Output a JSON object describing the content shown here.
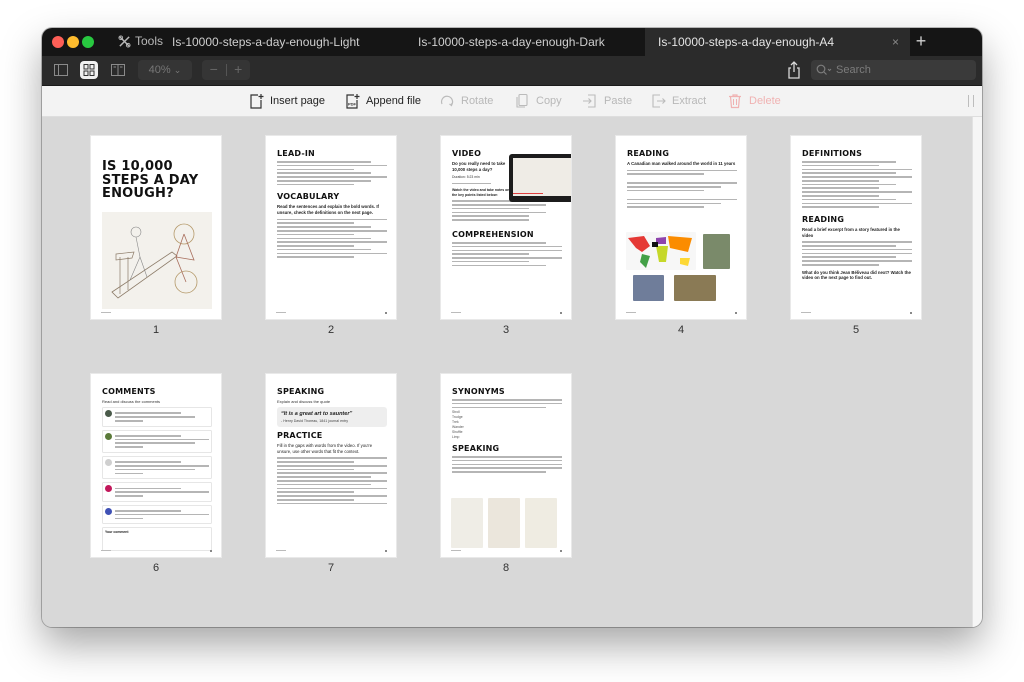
{
  "window": {
    "tools_label": "Tools",
    "tabs": [
      {
        "label": "Is-10000-steps-a-day-enough-Light",
        "active": false
      },
      {
        "label": "Is-10000-steps-a-day-enough-Dark",
        "active": false
      },
      {
        "label": "Is-10000-steps-a-day-enough-A4",
        "active": true
      }
    ],
    "close_glyph": "×",
    "new_tab_glyph": "+"
  },
  "toolbar": {
    "zoom_value": "40%",
    "zoom_chevron": "⌄",
    "zoom_out": "−",
    "zoom_in": "+",
    "search_placeholder": "Search",
    "view_modes": [
      "sidebar-view",
      "grid-view",
      "two-page-view"
    ],
    "active_view": "grid-view"
  },
  "actions": {
    "insert_page": "Insert page",
    "append_file": "Append file",
    "rotate": "Rotate",
    "copy": "Copy",
    "paste": "Paste",
    "extract": "Extract",
    "delete": "Delete"
  },
  "colors": {
    "traffic_red": "#fe5f57",
    "traffic_yellow": "#febc2e",
    "traffic_green": "#28c840",
    "delete_disabled": "#f0b2b2"
  },
  "pages": [
    {
      "number": "1",
      "title": "IS 10,000 STEPS A DAY ENOUGH?"
    },
    {
      "number": "2",
      "headings": [
        "LEAD-IN",
        "VOCABULARY"
      ],
      "vocab_instructions": "Read the sentences and explain the bold words. If unsure, check the definitions on the next page."
    },
    {
      "number": "3",
      "headings": [
        "VIDEO",
        "COMPREHENSION"
      ],
      "video_question": "Do you really need to take 10,000 steps a day?",
      "duration": "Duration: 5:23 min",
      "video_instructions": "Watch the video and take notes on the key points listed below:"
    },
    {
      "number": "4",
      "headings": [
        "READING"
      ],
      "subtitle": "A Canadian man walked around the world in 11 years"
    },
    {
      "number": "5",
      "headings": [
        "DEFINITIONS",
        "READING"
      ],
      "reading_intro": "Read a brief excerpt from a story featured in the video",
      "closing": "What do you think Jean Béliveau did next? Watch the video on the next page to find out."
    },
    {
      "number": "6",
      "headings": [
        "COMMENTS"
      ],
      "intro": "Read and discuss the comments",
      "your_comment": "Your comment"
    },
    {
      "number": "7",
      "headings": [
        "SPEAKING",
        "PRACTICE"
      ],
      "intro": "Explain and discuss the quote",
      "quote": "“It is a great art to saunter”",
      "attribution": "- Henry David Thoreau, 1841 journal entry",
      "practice_intro": "Fill in the gaps with words from the video. If you're unsure, use other words that fit the context."
    },
    {
      "number": "8",
      "headings": [
        "SYNONYMS",
        "SPEAKING"
      ],
      "synonyms": [
        "Stroll",
        "Trudge",
        "Trek",
        "Wander",
        "Shuffle",
        "Limp"
      ]
    }
  ]
}
